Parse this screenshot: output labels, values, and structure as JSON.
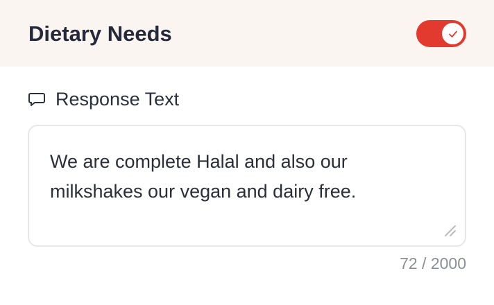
{
  "header": {
    "title": "Dietary Needs",
    "toggle": {
      "on": true,
      "icon": "check-icon",
      "color": "#e23a2f"
    }
  },
  "response": {
    "icon": "speech-bubble-icon",
    "label": "Response Text",
    "value": "We are complete Halal and also our milkshakes our vegan and dairy free.",
    "char_count": "72 / 2000"
  }
}
